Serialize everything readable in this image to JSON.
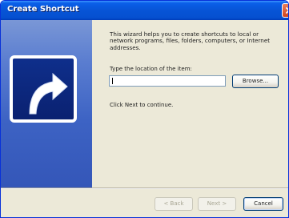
{
  "window": {
    "title": "Create Shortcut",
    "close_icon": "close-icon"
  },
  "sidebar": {
    "icon": "shortcut-arrow-icon"
  },
  "main": {
    "intro": "This wizard helps you to create shortcuts to local or network programs, files, folders, computers, or Internet addresses.",
    "location_label": "Type the location of the item:",
    "location_value": "",
    "browse_label": "Browse...",
    "hint": "Click Next to continue."
  },
  "footer": {
    "back_label": "< Back",
    "next_label": "Next >",
    "cancel_label": "Cancel"
  },
  "colors": {
    "title_bar": "#0754d6",
    "sidebar": "#3d63c4",
    "dialog_bg": "#ece9d8",
    "close_button": "#d2451c"
  }
}
